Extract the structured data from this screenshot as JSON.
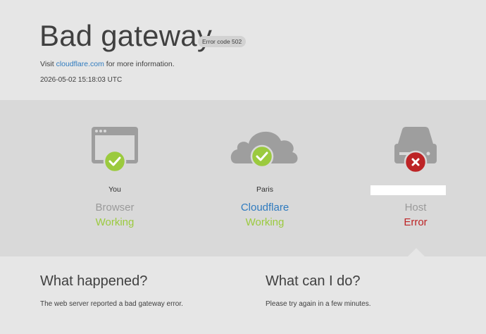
{
  "header": {
    "title": "Bad gateway",
    "error_badge": "Error code 502",
    "visit_prefix": "Visit",
    "visit_link": "cloudflare.com",
    "visit_suffix": "for more information.",
    "timestamp": "2026-05-02 15:18:03 UTC"
  },
  "nodes": [
    {
      "icon": "browser-window-icon",
      "location": "You",
      "kind": "Browser",
      "status": "Working",
      "status_icon": "check-icon"
    },
    {
      "icon": "cloud-icon",
      "location": "Paris",
      "kind": "Cloudflare",
      "status": "Working",
      "status_icon": "check-icon"
    },
    {
      "icon": "server-drive-icon",
      "location": "",
      "kind": "Host",
      "status": "Error",
      "status_icon": "x-icon"
    }
  ],
  "colors": {
    "ok": "#9bca3e",
    "error": "#bd2426",
    "link": "#2f7bbf",
    "icon_gray": "#9e9e9e"
  },
  "what_happened": {
    "heading": "What happened?",
    "text": "The web server reported a bad gateway error."
  },
  "what_can_i_do": {
    "heading": "What can I do?",
    "text": "Please try again in a few minutes."
  }
}
